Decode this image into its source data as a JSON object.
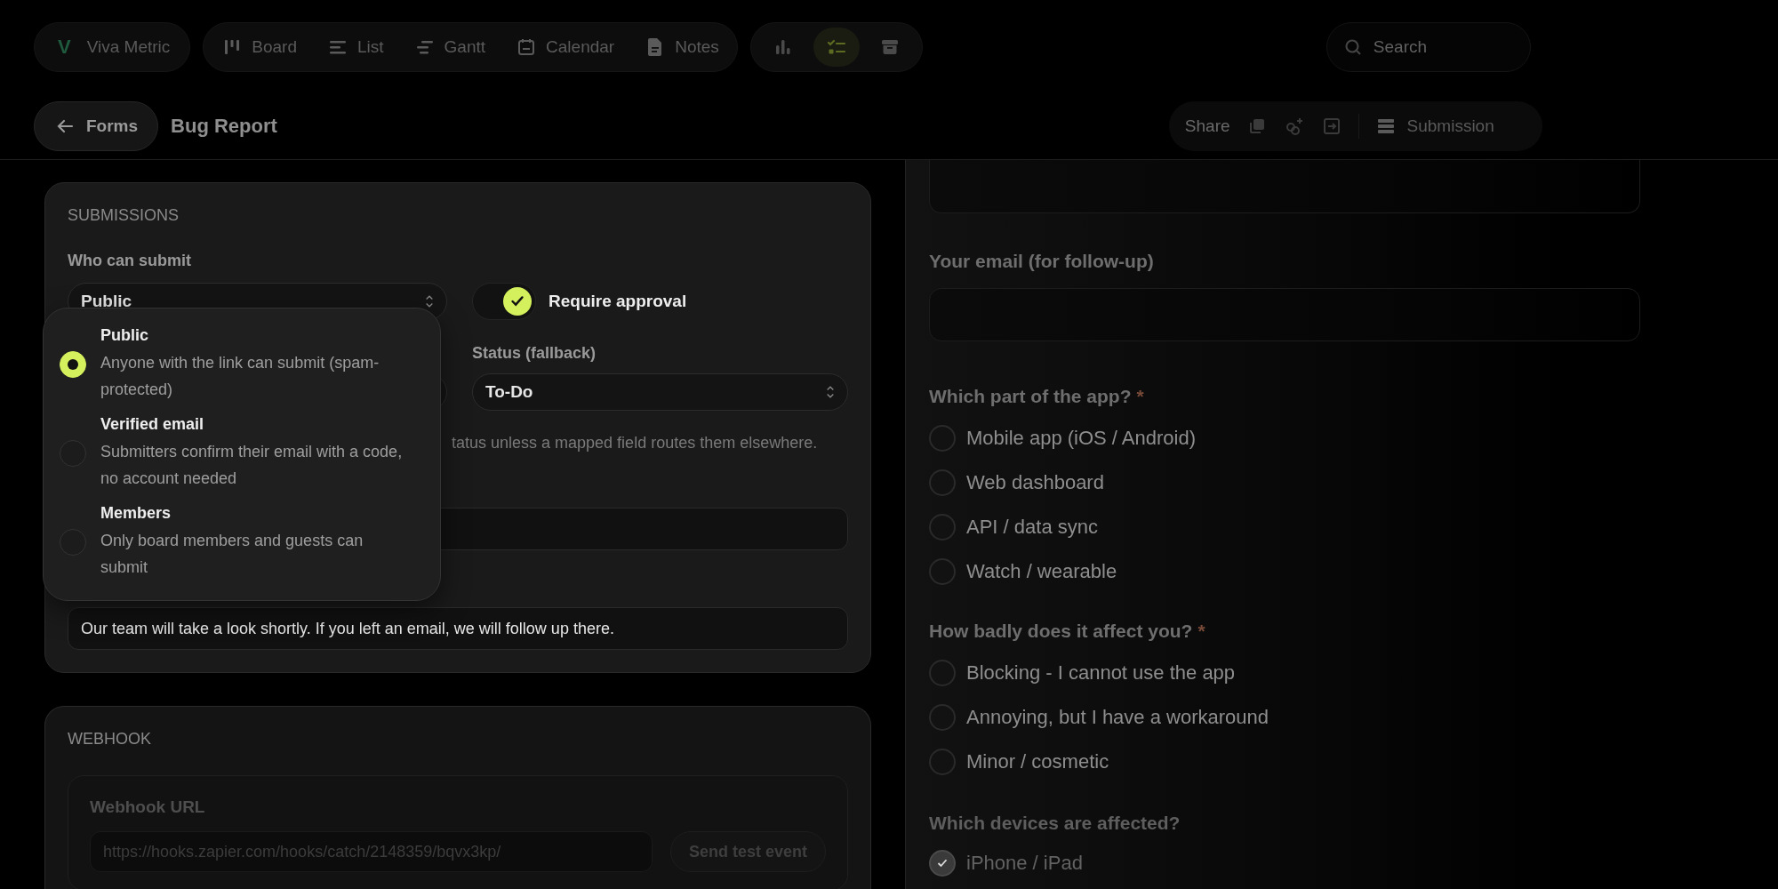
{
  "brand": {
    "letter": "V",
    "name": "Viva Metric"
  },
  "views": [
    {
      "label": "Board"
    },
    {
      "label": "List"
    },
    {
      "label": "Gantt"
    },
    {
      "label": "Calendar"
    },
    {
      "label": "Notes"
    }
  ],
  "tools": [
    {
      "selected": false
    },
    {
      "selected": true
    },
    {
      "selected": false
    }
  ],
  "search": {
    "placeholder": "Search"
  },
  "back": {
    "label": "Forms"
  },
  "title": "Bug Report",
  "toolbar": {
    "share": "Share",
    "submissions": "Submission"
  },
  "submissions_card": {
    "heading": "SUBMISSIONS",
    "who_label": "Who can submit",
    "who_value": "Public",
    "approval": {
      "label": "Require approval",
      "on": true
    },
    "status_label": "Status (fallback)",
    "status_value": "To-Do",
    "help_fragment": "tatus unless a mapped field routes them elsewhere.",
    "message_value": "Our team will take a look shortly. If you left an email, we will follow up there."
  },
  "dropdown": {
    "options": [
      {
        "title": "Public",
        "description": "Anyone with the link can submit (spam-protected)",
        "selected": true
      },
      {
        "title": "Verified email",
        "description": "Submitters confirm their email with a code, no account needed",
        "selected": false
      },
      {
        "title": "Members",
        "description": "Only board members and guests can submit",
        "selected": false
      }
    ]
  },
  "webhook": {
    "heading": "WEBHOOK",
    "url_label": "Webhook URL",
    "url_value": "https://hooks.zapier.com/hooks/catch/2148359/bqvx3kp/",
    "test_button": "Send test event"
  },
  "preview": {
    "email_label": "Your email (for follow-up)",
    "questions": [
      {
        "label": "Which part of the app?",
        "required_mark": "*",
        "kind": "radio",
        "options": [
          {
            "label": "Mobile app (iOS / Android)",
            "selected": false
          },
          {
            "label": "Web dashboard",
            "selected": false
          },
          {
            "label": "API / data sync",
            "selected": false
          },
          {
            "label": "Watch / wearable",
            "selected": false
          }
        ]
      },
      {
        "label": "How badly does it affect you?",
        "required_mark": "*",
        "kind": "radio",
        "options": [
          {
            "label": "Blocking - I cannot use the app",
            "selected": false
          },
          {
            "label": "Annoying, but I have a workaround",
            "selected": false
          },
          {
            "label": "Minor / cosmetic",
            "selected": false
          }
        ]
      },
      {
        "label": "Which devices are affected?",
        "kind": "checkbox",
        "options": [
          {
            "label": "iPhone / iPad",
            "checked": true
          }
        ]
      }
    ]
  }
}
